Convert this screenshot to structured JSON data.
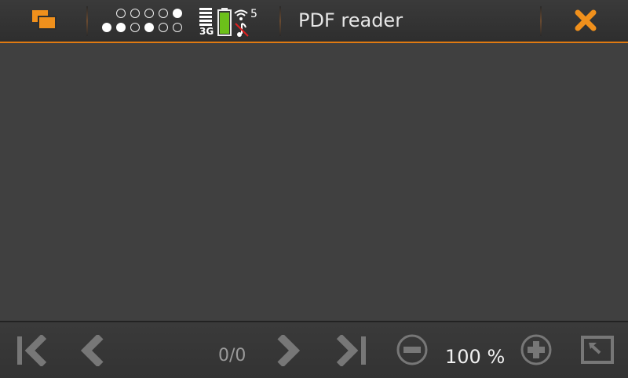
{
  "header": {
    "title": "PDF reader",
    "status": {
      "network": "3G",
      "wifi_count": "5"
    },
    "icons": {
      "task_switcher": "task-switcher-icon",
      "close": "close-icon",
      "battery": "battery-icon",
      "signal": "signal-icon",
      "wifi": "wifi-icon",
      "music": "music-off-icon"
    },
    "accent_color": "#f0901c"
  },
  "toolbar": {
    "page_count": "0/0",
    "zoom_level": "100 %",
    "icons": [
      "first-page-icon",
      "previous-page-icon",
      "next-page-icon",
      "last-page-icon",
      "zoom-out-icon",
      "zoom-in-icon",
      "fullscreen-icon"
    ]
  }
}
